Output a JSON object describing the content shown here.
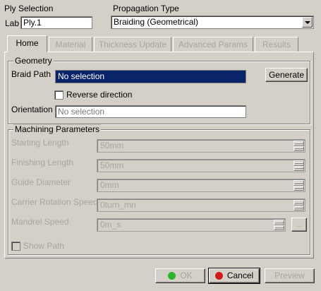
{
  "header": {
    "ply_selection_label": "Ply Selection",
    "lab_label": "Lab",
    "ply_value": "Ply.1",
    "propagation_type_label": "Propagation Type",
    "propagation_value": "Braiding (Geometrical)"
  },
  "tabs": [
    {
      "label": "Home",
      "active": true
    },
    {
      "label": "Material",
      "active": false
    },
    {
      "label": "Thickness Update",
      "active": false
    },
    {
      "label": "Advanced Params",
      "active": false
    },
    {
      "label": "Results",
      "active": false
    }
  ],
  "geometry": {
    "title": "Geometry",
    "braid_path_label": "Braid Path",
    "braid_path_value": "No selection",
    "generate_label": "Generate",
    "reverse_direction_label": "Reverse direction",
    "reverse_direction_checked": false,
    "orientation_label": "Orientation",
    "orientation_value": "No selection"
  },
  "machining": {
    "title": "Machining Parameters",
    "starting_length_label": "Starting Length",
    "starting_length_value": "50mm",
    "finishing_length_label": "Finishing Length",
    "finishing_length_value": "50mm",
    "guide_diameter_label": "Guide Diameter",
    "guide_diameter_value": "0mm",
    "carrier_rotation_label": "Carrier Rotation Speed",
    "carrier_rotation_value": "0turn_mn",
    "mandrel_speed_label": "Mandrel Speed",
    "mandrel_speed_value": "0m_s",
    "more_label": "...",
    "show_path_label": "Show Path",
    "show_path_checked": false
  },
  "footer": {
    "ok_label": "OK",
    "cancel_label": "Cancel",
    "preview_label": "Preview"
  },
  "colors": {
    "background": "#d4d0c8",
    "selection": "#0a246a",
    "disabled_text": "#a9a59d",
    "ok_dot": "#2bb52b",
    "cancel_dot": "#d11a1a"
  }
}
